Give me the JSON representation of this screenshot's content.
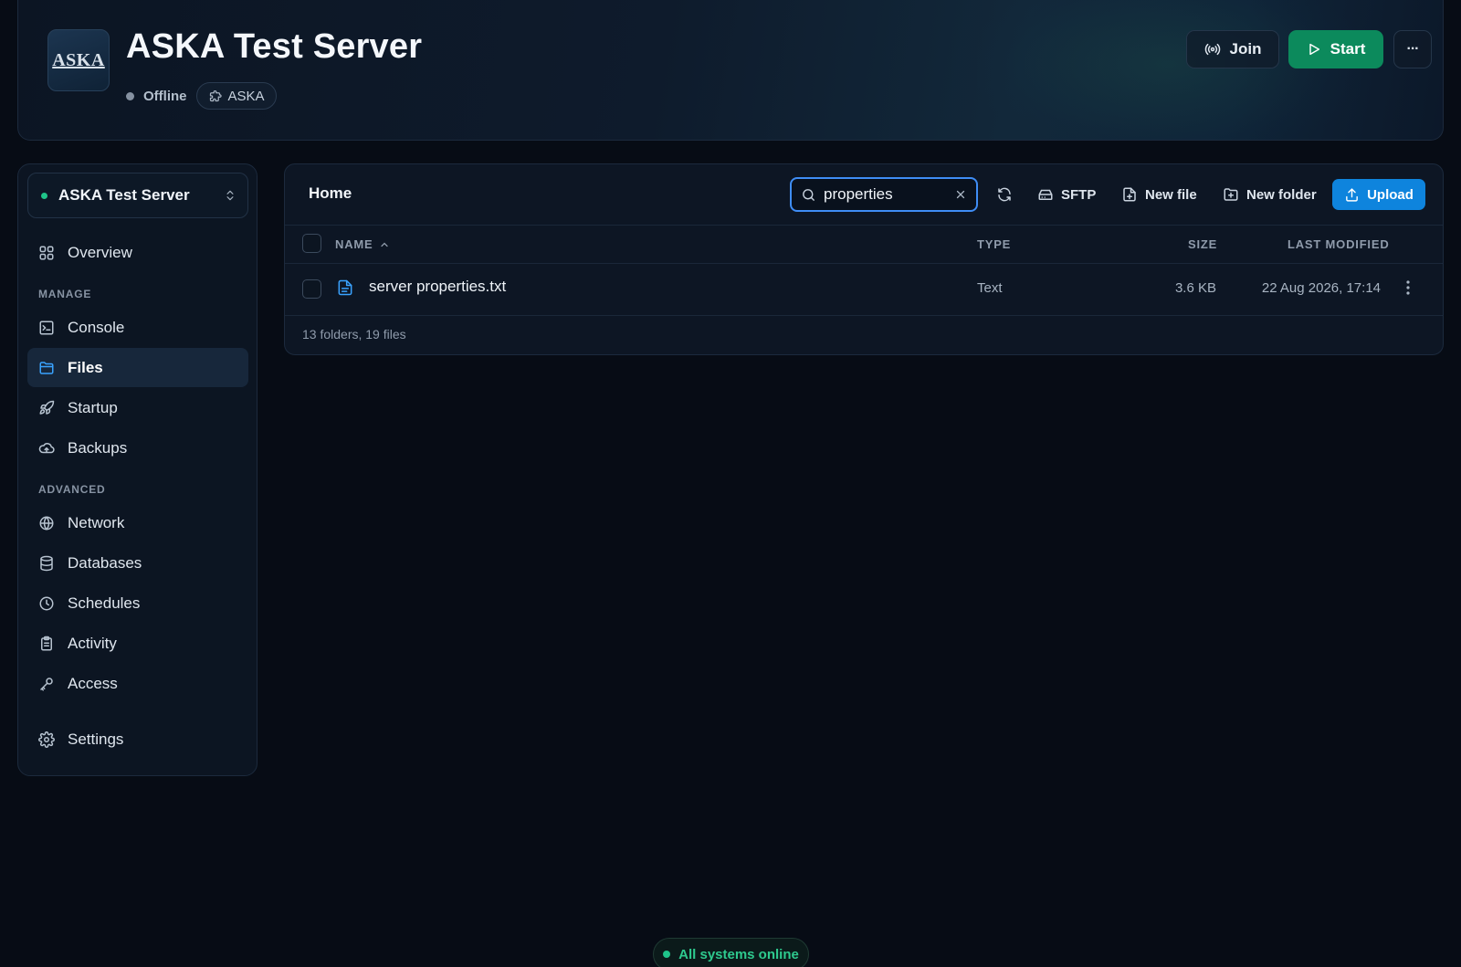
{
  "header": {
    "logo_text": "ASKA",
    "title": "ASKA Test Server",
    "status": "Offline",
    "game_tag": "ASKA",
    "join_label": "Join",
    "start_label": "Start",
    "more_label": "···"
  },
  "sidebar": {
    "server_name": "ASKA Test Server",
    "overview": "Overview",
    "manage_label": "MANAGE",
    "console": "Console",
    "files": "Files",
    "startup": "Startup",
    "backups": "Backups",
    "advanced_label": "ADVANCED",
    "network": "Network",
    "databases": "Databases",
    "schedules": "Schedules",
    "activity": "Activity",
    "access": "Access",
    "settings": "Settings"
  },
  "files": {
    "title": "Home",
    "search_value": "properties",
    "sftp_label": "SFTP",
    "new_file_label": "New file",
    "new_folder_label": "New folder",
    "upload_label": "Upload",
    "columns": {
      "name": "NAME",
      "type": "TYPE",
      "size": "SIZE",
      "modified": "LAST MODIFIED"
    },
    "rows": [
      {
        "name": "server properties.txt",
        "type": "Text",
        "size": "3.6 KB",
        "modified": "22 Aug 2026, 17:14"
      }
    ],
    "summary": "13 folders, 19 files"
  },
  "status_bar": {
    "text": "All systems online"
  },
  "colors": {
    "background": "#070c15",
    "accent_blue": "#0e84dd",
    "start_green": "#0c8a5c",
    "online_green": "#1fc48a"
  }
}
